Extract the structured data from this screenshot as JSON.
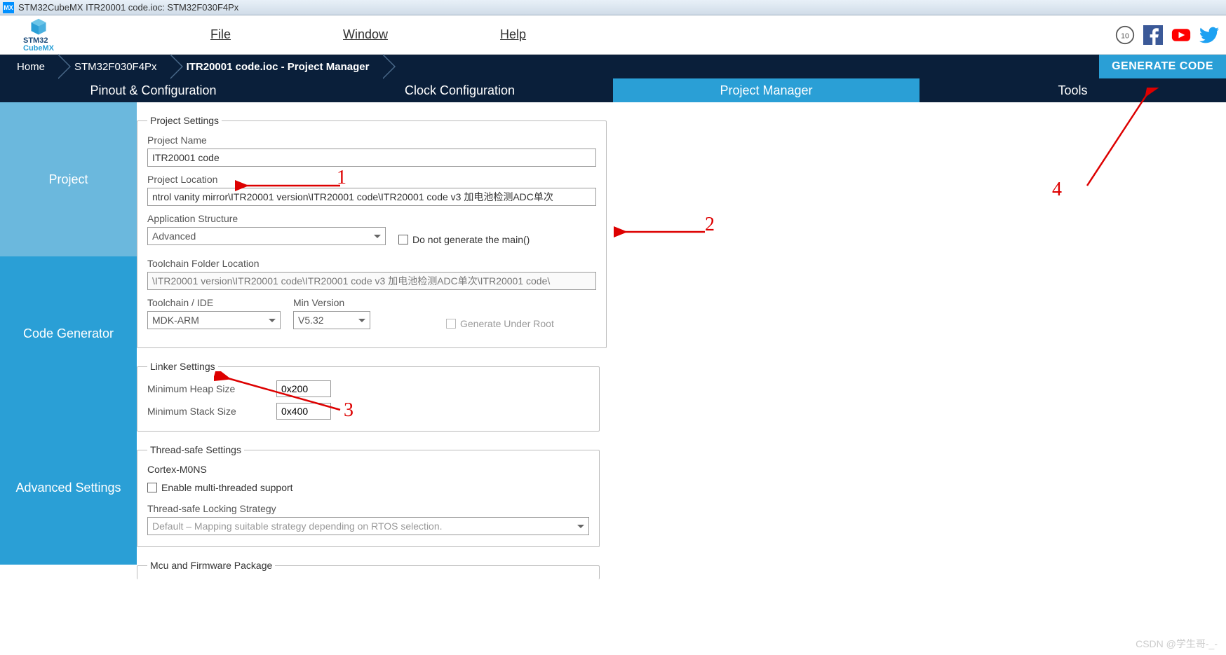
{
  "window": {
    "title": "STM32CubeMX ITR20001 code.ioc: STM32F030F4Px"
  },
  "logo": {
    "line1": "STM32",
    "line2": "CubeMX"
  },
  "menu": {
    "file": "File",
    "window": "Window",
    "help": "Help"
  },
  "breadcrumb": {
    "home": "Home",
    "chip": "STM32F030F4Px",
    "proj": "ITR20001 code.ioc - Project Manager",
    "generate": "GENERATE CODE"
  },
  "tabs": {
    "pinout": "Pinout & Configuration",
    "clock": "Clock Configuration",
    "pm": "Project Manager",
    "tools": "Tools"
  },
  "sidebar": {
    "project": "Project",
    "codegen": "Code Generator",
    "advanced": "Advanced Settings"
  },
  "project_settings": {
    "legend": "Project Settings",
    "name_label": "Project Name",
    "name_value": "ITR20001 code",
    "location_label": "Project Location",
    "location_value": "ntrol vanity mirror\\ITR20001 version\\ITR20001 code\\ITR20001 code v3 加电池检测ADC单次",
    "appstruct_label": "Application Structure",
    "appstruct_value": "Advanced",
    "no_main_label": "Do not generate the main()",
    "toolchain_folder_label": "Toolchain Folder Location",
    "toolchain_folder_value": "\\ITR20001 version\\ITR20001 code\\ITR20001 code v3 加电池检测ADC单次\\ITR20001 code\\",
    "toolchain_label": "Toolchain / IDE",
    "toolchain_value": "MDK-ARM",
    "minver_label": "Min Version",
    "minver_value": "V5.32",
    "gen_under_root": "Generate Under Root"
  },
  "linker": {
    "legend": "Linker Settings",
    "heap_label": "Minimum Heap Size",
    "heap_value": "0x200",
    "stack_label": "Minimum Stack Size",
    "stack_value": "0x400"
  },
  "thread": {
    "legend": "Thread-safe Settings",
    "core": "Cortex-M0NS",
    "enable_label": "Enable multi-threaded support",
    "strategy_label": "Thread-safe Locking Strategy",
    "strategy_value": "Default – Mapping suitable strategy depending on RTOS selection."
  },
  "mcu": {
    "legend": "Mcu and Firmware Package"
  },
  "annotations": {
    "a1": "1",
    "a2": "2",
    "a3": "3",
    "a4": "4"
  },
  "watermark": "CSDN @学生哥-_-"
}
